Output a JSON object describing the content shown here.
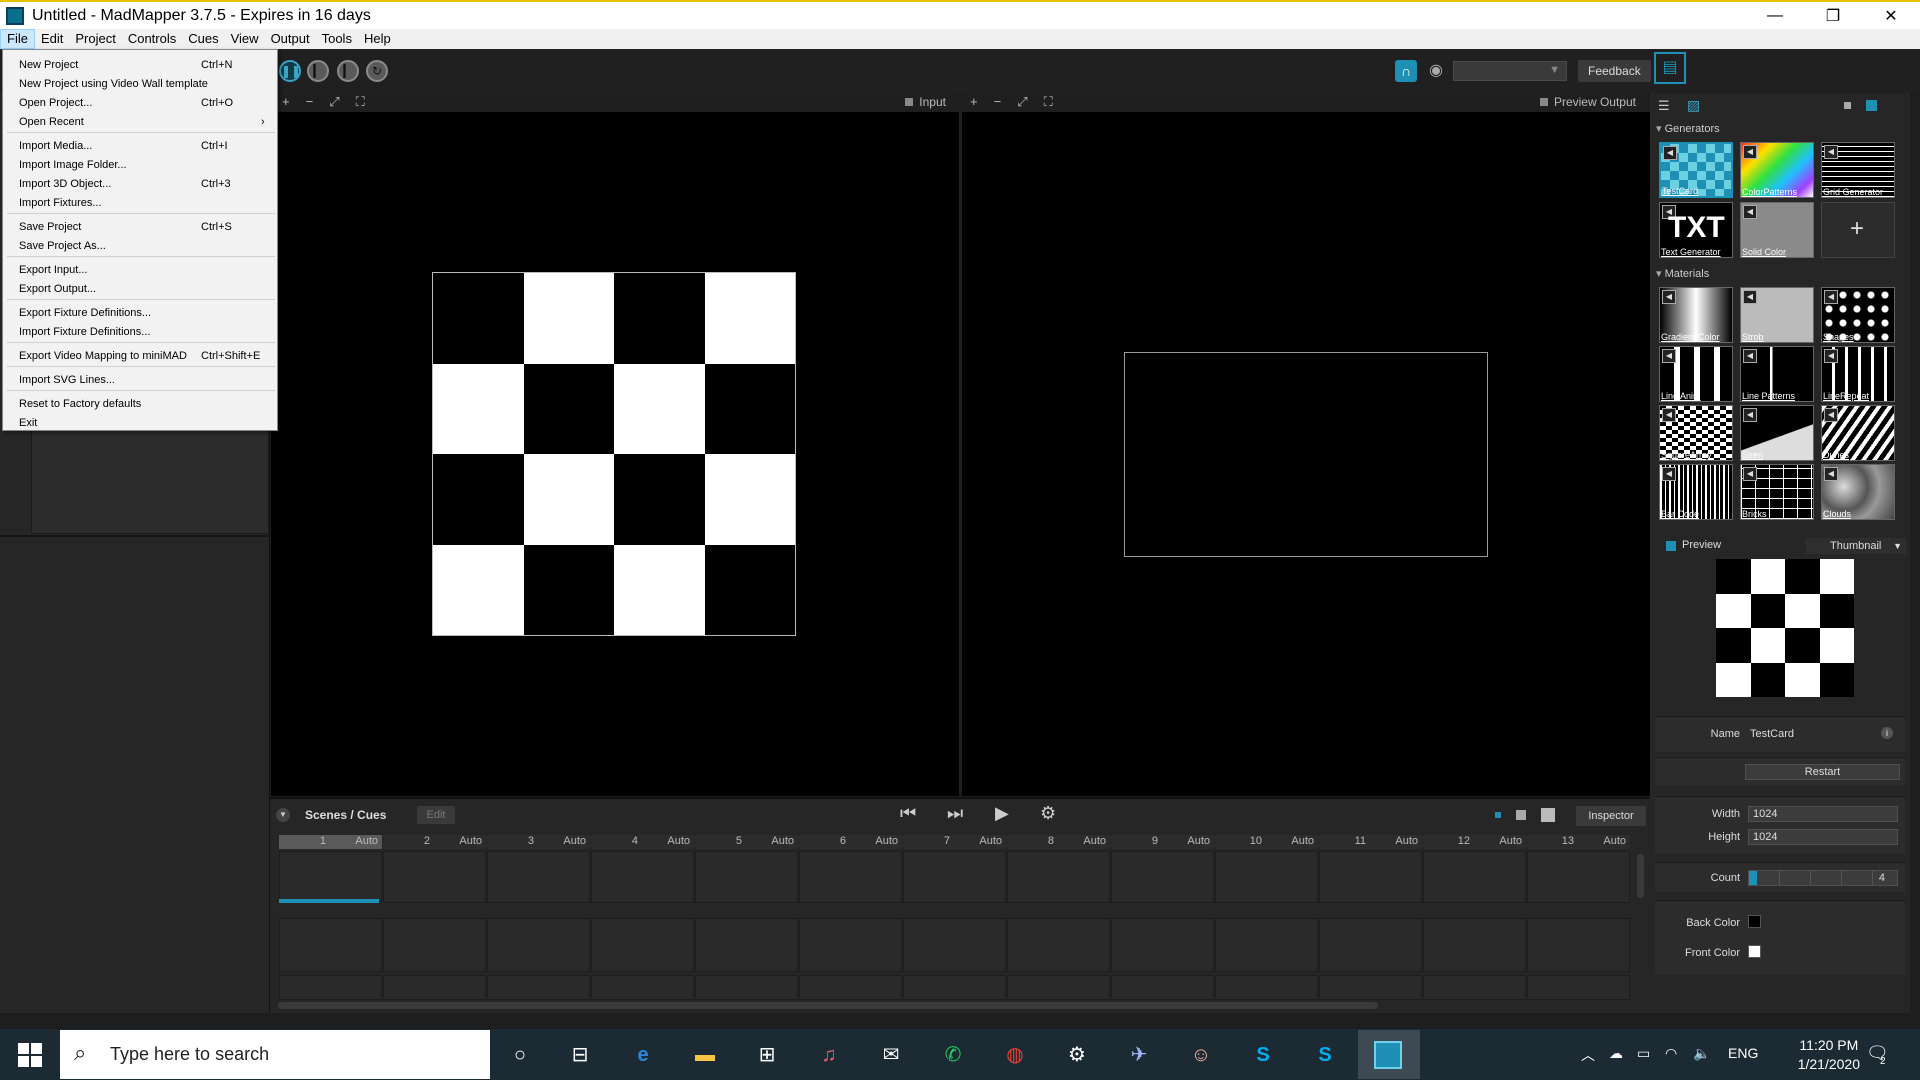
{
  "window": {
    "title": "Untitled - MadMapper 3.7.5 - Expires in 16 days",
    "minimize": "—",
    "restore": "❐",
    "close": "✕"
  },
  "menubar": [
    "File",
    "Edit",
    "Project",
    "Controls",
    "Cues",
    "View",
    "Output",
    "Tools",
    "Help"
  ],
  "file_menu": {
    "items": [
      {
        "label": "New Project",
        "shortcut": "Ctrl+N"
      },
      {
        "label": "New Project using Video Wall template",
        "shortcut": ""
      },
      {
        "label": "Open Project...",
        "shortcut": "Ctrl+O"
      },
      {
        "label": "Open Recent",
        "shortcut": "›"
      },
      {
        "label": "Import Media...",
        "shortcut": "Ctrl+I"
      },
      {
        "label": "Import Image Folder...",
        "shortcut": ""
      },
      {
        "label": "Import 3D Object...",
        "shortcut": "Ctrl+3"
      },
      {
        "label": "Import Fixtures...",
        "shortcut": ""
      },
      {
        "label": "Save Project",
        "shortcut": "Ctrl+S"
      },
      {
        "label": "Save Project As...",
        "shortcut": ""
      },
      {
        "label": "Export Input...",
        "shortcut": ""
      },
      {
        "label": "Export Output...",
        "shortcut": ""
      },
      {
        "label": "Export Fixture Definitions...",
        "shortcut": ""
      },
      {
        "label": "Import Fixture Definitions...",
        "shortcut": ""
      },
      {
        "label": "Export Video Mapping to miniMAD",
        "shortcut": "Ctrl+Shift+E"
      },
      {
        "label": "Import SVG Lines...",
        "shortcut": ""
      },
      {
        "label": "Reset to Factory defaults",
        "shortcut": ""
      },
      {
        "label": "Exit",
        "shortcut": ""
      }
    ]
  },
  "toolbar": {
    "feedback_label": "Feedback"
  },
  "input_view": {
    "label": "Input"
  },
  "output_view": {
    "label": "Preview Output"
  },
  "generators": {
    "title": "Generators",
    "tiles": [
      "TestCard",
      "ColorPatterns",
      "Grid Generator",
      "Text Generator",
      "Solid Color"
    ],
    "add_label": "+"
  },
  "materials": {
    "title": "Materials",
    "tiles": [
      "Gradient Color",
      "Strob",
      "Shapes",
      "Line Anim",
      "Line Patterns",
      "LineRepeat",
      "SquareArray",
      "Siren",
      "Dunes",
      "Bar Code",
      "Bricks",
      "Clouds"
    ]
  },
  "preview": {
    "title": "Preview",
    "mode": "Thumbnail"
  },
  "properties": {
    "name_label": "Name",
    "name_value": "TestCard",
    "restart_label": "Restart",
    "width_label": "Width",
    "width_value": "1024",
    "height_label": "Height",
    "height_value": "1024",
    "count_label": "Count",
    "count_value": "4",
    "back_color_label": "Back Color",
    "front_color_label": "Front Color"
  },
  "colors": {
    "accent": "#1e8fb5",
    "back_color": "#000000",
    "front_color": "#ffffff"
  },
  "cues": {
    "title": "Scenes / Cues",
    "edit_label": "Edit",
    "inspector_label": "Inspector",
    "columns": [
      {
        "num": "1",
        "mode": "Auto"
      },
      {
        "num": "2",
        "mode": "Auto"
      },
      {
        "num": "3",
        "mode": "Auto"
      },
      {
        "num": "4",
        "mode": "Auto"
      },
      {
        "num": "5",
        "mode": "Auto"
      },
      {
        "num": "6",
        "mode": "Auto"
      },
      {
        "num": "7",
        "mode": "Auto"
      },
      {
        "num": "8",
        "mode": "Auto"
      },
      {
        "num": "9",
        "mode": "Auto"
      },
      {
        "num": "10",
        "mode": "Auto"
      },
      {
        "num": "11",
        "mode": "Auto"
      },
      {
        "num": "12",
        "mode": "Auto"
      },
      {
        "num": "13",
        "mode": "Auto"
      }
    ]
  },
  "taskbar": {
    "search_placeholder": "Type here to search",
    "language": "ENG",
    "time": "11:20 PM",
    "date": "1/21/2020",
    "notification_count": "2"
  }
}
